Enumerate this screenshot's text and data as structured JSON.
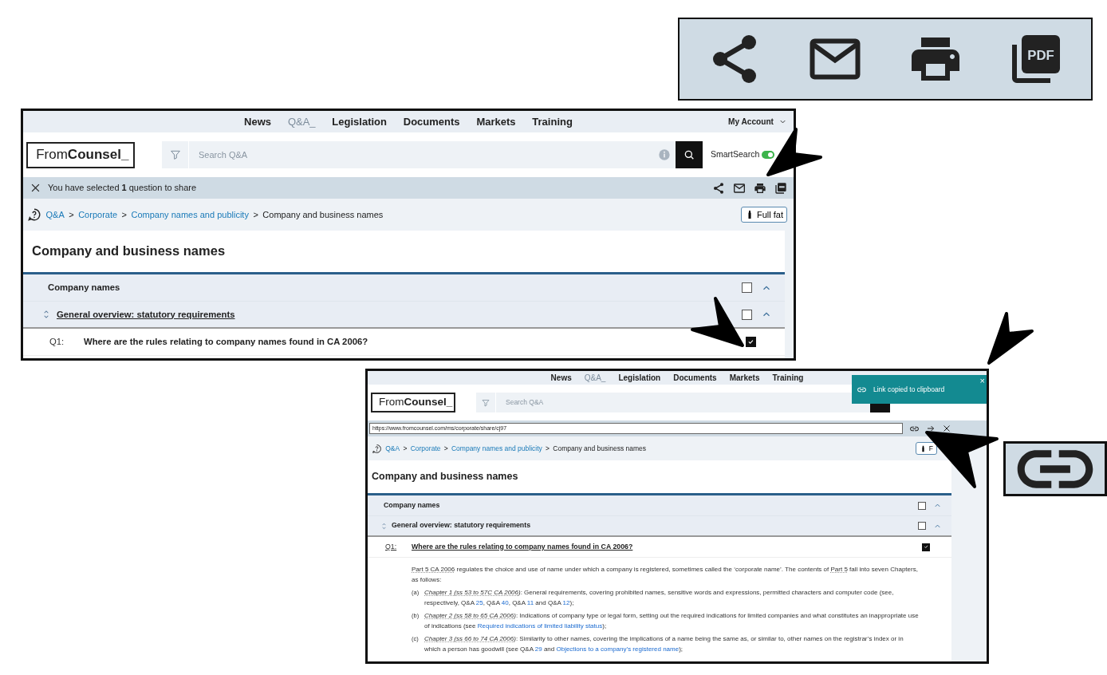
{
  "action_icons_zoom": {
    "items": [
      {
        "kind": "share"
      },
      {
        "kind": "email"
      },
      {
        "kind": "print"
      },
      {
        "kind": "pdf",
        "label": "PDF"
      }
    ]
  },
  "views": [
    {
      "kind": "selection",
      "nav": {
        "items": [
          {
            "label": "News",
            "selected": false
          },
          {
            "label": "Q&A_",
            "selected": true
          },
          {
            "label": "Legislation",
            "selected": false
          },
          {
            "label": "Documents",
            "selected": false
          },
          {
            "label": "Markets",
            "selected": false
          },
          {
            "label": "Training",
            "selected": false
          }
        ],
        "account": "My Account"
      },
      "logo": "From**Counsel_**",
      "search": {
        "placeholder": "Search Q&A"
      },
      "smart_search": {
        "label": "SmartSearch",
        "on": true
      },
      "share_bar": {
        "message": "You have selected **1** question to share",
        "actions": [
          {
            "kind": "share"
          },
          {
            "kind": "email"
          },
          {
            "kind": "print"
          },
          {
            "kind": "pdf"
          }
        ]
      },
      "breadcrumb": {
        "separator": ">",
        "items": [
          {
            "label": "Q&A",
            "link": true
          },
          {
            "label": "Corporate",
            "link": true
          },
          {
            "label": "Company names and publicity",
            "link": true
          },
          {
            "label": "Company and business names",
            "link": false
          }
        ]
      },
      "view_button": "Full fat",
      "title": "Company and business names",
      "sections": [
        {
          "label": "Company names",
          "link": false,
          "sortable": false,
          "checked": false,
          "expanded": true
        },
        {
          "label": "General overview: statutory requirements",
          "link": true,
          "sortable": true,
          "checked": false,
          "expanded": true
        }
      ],
      "question": {
        "number": "Q1:",
        "text": "Where are the rules relating to company names found in CA 2006?",
        "link": false,
        "checked": true
      }
    },
    {
      "kind": "share_link",
      "nav": {
        "items": [
          {
            "label": "News",
            "selected": false
          },
          {
            "label": "Q&A_",
            "selected": true
          },
          {
            "label": "Legislation",
            "selected": false
          },
          {
            "label": "Documents",
            "selected": false
          },
          {
            "label": "Markets",
            "selected": false
          },
          {
            "label": "Training",
            "selected": false
          }
        ]
      },
      "logo": "From**Counsel_**",
      "search": {
        "placeholder": "Search Q&A"
      },
      "link_bar": {
        "url": "https://www.fromcounsel.com/ms/corporate/share/cj97"
      },
      "breadcrumb": {
        "separator": ">",
        "items": [
          {
            "label": "Q&A",
            "link": true
          },
          {
            "label": "Corporate",
            "link": true
          },
          {
            "label": "Company names and publicity",
            "link": true
          },
          {
            "label": "Company and business names",
            "link": false
          }
        ]
      },
      "view_button": "F",
      "title": "Company and business names",
      "sections": [
        {
          "label": "Company names",
          "link": false,
          "sortable": false,
          "checked": false,
          "expanded": true
        },
        {
          "label": "General overview: statutory requirements",
          "link": false,
          "sortable": true,
          "checked": false,
          "expanded": true
        }
      ],
      "question": {
        "number": "Q1:",
        "text": "Where are the rules relating to company names found in CA 2006?",
        "link": true,
        "checked": true
      },
      "body": {
        "paragraph": [
          {
            "kind": "ref",
            "text": "Part 5 CA 2006"
          },
          {
            "kind": "text",
            "text": " regulates the choice and use of name under which a company is registered, sometimes called the ‘corporate name’. The contents of "
          },
          {
            "kind": "ref",
            "text": "Part 5"
          },
          {
            "kind": "text",
            "text": " fall into seven Chapters, as follows:"
          }
        ],
        "items": [
          {
            "marker": "(a)",
            "parts": [
              {
                "kind": "ref",
                "text": "*Chapter 1 (ss 53 to 57C CA 2006)*"
              },
              {
                "kind": "text",
                "text": ": General requirements, covering prohibited names, sensitive words and expressions, permitted characters and computer code (see, respectively, Q&A "
              },
              {
                "kind": "link",
                "text": "25"
              },
              {
                "kind": "text",
                "text": ", Q&A "
              },
              {
                "kind": "link",
                "text": "40"
              },
              {
                "kind": "text",
                "text": ", Q&A "
              },
              {
                "kind": "link",
                "text": "11"
              },
              {
                "kind": "text",
                "text": " and Q&A "
              },
              {
                "kind": "link",
                "text": "12"
              },
              {
                "kind": "text",
                "text": ");"
              }
            ]
          },
          {
            "marker": "(b)",
            "parts": [
              {
                "kind": "ref",
                "text": "*Chapter 2 (ss 58 to 65 CA 2006)*"
              },
              {
                "kind": "text",
                "text": ": Indications of company type or legal form, setting out the required indications for limited companies and what constitutes an inappropriate use of indications (see "
              },
              {
                "kind": "link",
                "text": "Required indications of limited liability status"
              },
              {
                "kind": "text",
                "text": ");"
              }
            ]
          },
          {
            "marker": "(c)",
            "parts": [
              {
                "kind": "ref",
                "text": "*Chapter 3 (ss 66 to 74 CA 2006)*"
              },
              {
                "kind": "text",
                "text": ": Similarity to other names, covering the implications of a name being the same as, or similar to, other names on the registrar’s index or in which a person has goodwill (see Q&A "
              },
              {
                "kind": "link",
                "text": "29"
              },
              {
                "kind": "text",
                "text": " and "
              },
              {
                "kind": "link",
                "text": "Objections to a company’s registered name"
              },
              {
                "kind": "text",
                "text": ");"
              }
            ]
          }
        ]
      },
      "toast": {
        "message": "Link copied to clipboard",
        "close": "×"
      }
    }
  ]
}
